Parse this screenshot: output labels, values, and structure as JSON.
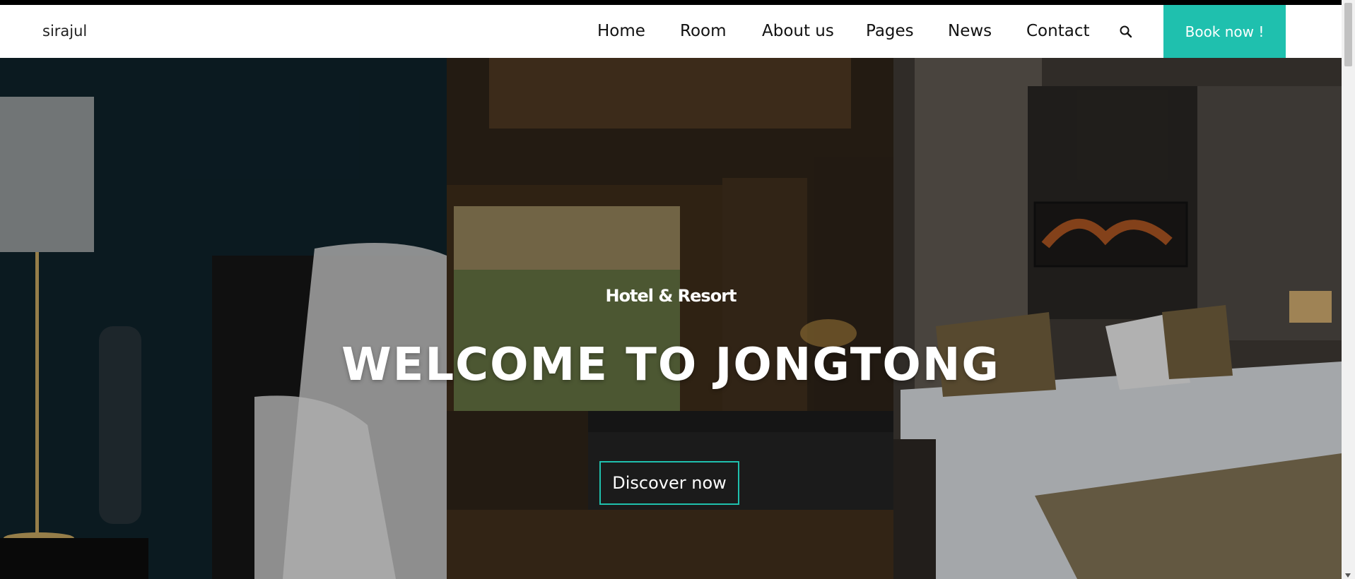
{
  "header": {
    "brand": "sirajul",
    "nav": [
      "Home",
      "Room",
      "About us",
      "Pages",
      "News",
      "Contact"
    ],
    "search_icon": "search-icon",
    "cta": "Book now !"
  },
  "hero": {
    "eyebrow": "Hotel & Resort",
    "title": "WELCOME TO JONGTONG",
    "button": "Discover now"
  },
  "colors": {
    "accent": "#1fc0ae",
    "text_dark": "#111111",
    "topbar": "#000000"
  }
}
